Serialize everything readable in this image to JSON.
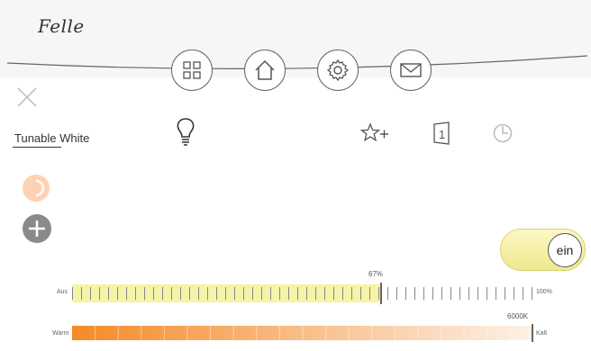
{
  "header": {
    "logo_text": "Felle"
  },
  "nav": [
    {
      "name": "grid-icon"
    },
    {
      "name": "home-icon"
    },
    {
      "name": "gear-icon"
    },
    {
      "name": "mail-icon"
    }
  ],
  "device": {
    "title": "Tunable White"
  },
  "toolbar": {
    "icons": [
      "lightbulb-icon",
      "star-plus-icon",
      "room-number-icon",
      "clock-icon"
    ],
    "room_number": "1"
  },
  "toggle": {
    "label": "ein",
    "state": "on"
  },
  "brightness": {
    "min_label": "Aus",
    "max_label": "100%",
    "value_label": "67%",
    "value": 67
  },
  "color_temp": {
    "min_label": "Warm",
    "max_label": "Kalt",
    "value_label": "6000K"
  },
  "colors": {
    "accent_yellow": "#f7f3a8",
    "accent_orange": "#f48a28"
  }
}
